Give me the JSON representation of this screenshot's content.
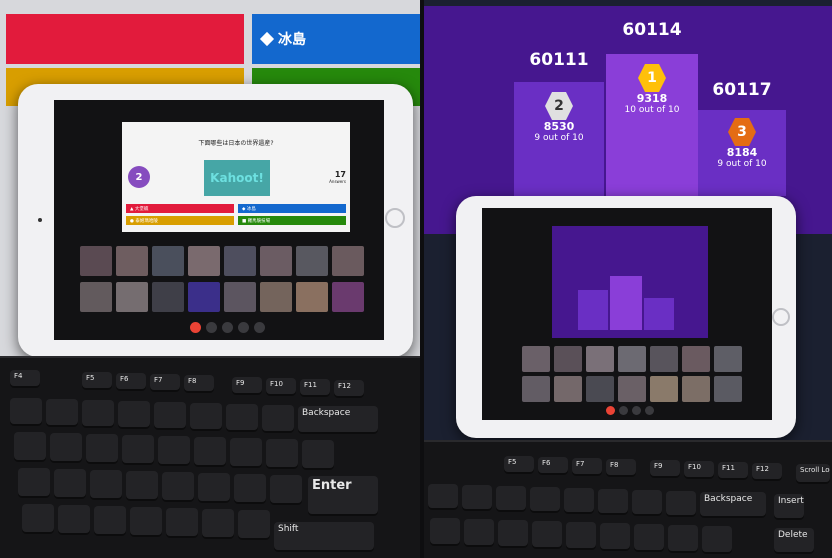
{
  "wall_answers": [
    {
      "label": ""
    },
    {
      "label": "冰島"
    },
    {
      "label": ""
    },
    {
      "label": ""
    }
  ],
  "left_tablet": {
    "question": "下面哪些は日本の世界遺産?",
    "timer": "2",
    "logo": "Kahoot!",
    "answer_count": "17",
    "answer_count_label": "Answers",
    "answers": [
      "▲ 大堡礁",
      "◆ 冰島",
      "● 泰姬瑪哈陵",
      "■ 羅馬競技場"
    ]
  },
  "keyboard_left": {
    "fn_row": [
      "F4",
      "F5",
      "F6",
      "F7",
      "F8",
      "F9",
      "F10",
      "F11",
      "F12"
    ],
    "special": {
      "backspace": "Backspace",
      "enter": "Enter",
      "shift": "Shift"
    }
  },
  "podium": [
    {
      "name": "60111",
      "rank": "2",
      "score": "8530",
      "detail": "9 out of 10",
      "color": "#e0e0e0"
    },
    {
      "name": "60114",
      "rank": "1",
      "score": "9318",
      "detail": "10 out of 10",
      "color": "#ffc00a"
    },
    {
      "name": "60117",
      "rank": "3",
      "score": "8184",
      "detail": "9 out of 10",
      "color": "#e46c14"
    }
  ],
  "keyboard_right": {
    "fn_row": [
      "F5",
      "F6",
      "F7",
      "F8",
      "F9",
      "F10",
      "F11",
      "F12"
    ],
    "special": {
      "backspace": "Backspace",
      "insert": "Insert",
      "delete": "Delete",
      "scroll_lock": "Scroll Lock"
    }
  },
  "colors": {
    "kahoot_purple": "#46178f",
    "red": "#e21b3c",
    "blue": "#1368ce",
    "yellow": "#d89e00",
    "green": "#26890c"
  }
}
